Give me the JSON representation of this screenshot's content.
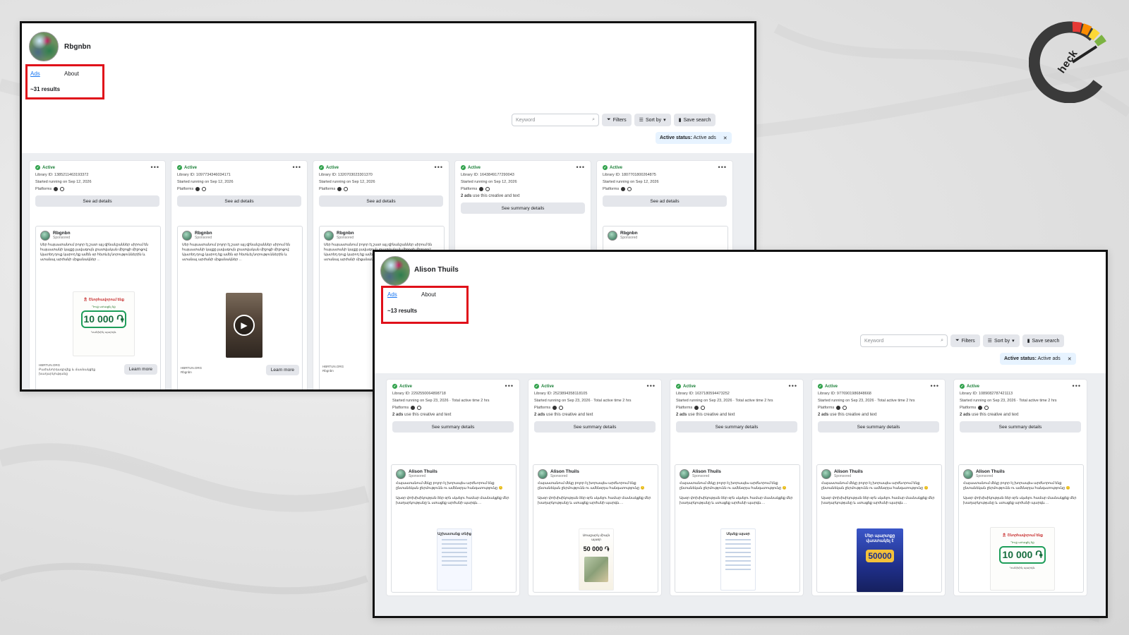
{
  "logo": {
    "text": "heck"
  },
  "common": {
    "tabs": {
      "ads": "Ads",
      "about": "About"
    },
    "keyword_placeholder": "Keyword",
    "filters": "Filters",
    "sort_by": "Sort by",
    "save_search": "Save search",
    "active_status_label": "Active status:",
    "active_status_value": "Active ads",
    "status_active": "Active",
    "platforms": "Platforms",
    "see_ad_details": "See ad details",
    "see_summary_details": "See summary details",
    "sponsored": "Sponsored",
    "learn_more": "Learn more",
    "ads_use_count": "2 ads",
    "ads_use_text": " use this creative and text"
  },
  "window1": {
    "page_name": "Rbgnbn",
    "results": "~31 results",
    "cards": [
      {
        "library_id": "Library ID: 1385211463193372",
        "started": "Started running on Sep 12, 2026",
        "summary": false,
        "creative": "prize",
        "domain": "HBRTUN.ORG",
        "domain_sub": "Բաժանորդագրվեք և մասնակցեք խաղարկությանը",
        "cta": true
      },
      {
        "library_id": "Library ID: 1097734346034171",
        "started": "Started running on Sep 12, 2026",
        "summary": false,
        "creative": "video",
        "domain": "HBRTUN.ORG",
        "domain_sub": "Rbgnbn",
        "cta": true
      },
      {
        "library_id": "Library ID: 1320703023301370",
        "started": "Started running on Sep 12, 2026",
        "summary": false,
        "creative": "none",
        "domain": "HBRTUN.ORG",
        "domain_sub": "Rbgnbn",
        "cta": false
      },
      {
        "library_id": "Library ID: 1643849177290043",
        "started": "Started running on Sep 12, 2026",
        "summary": true
      },
      {
        "library_id": "Library ID: 1807701800264875",
        "started": "Started running on Sep 12, 2026",
        "summary": false
      }
    ],
    "ad_text": "Սեր հայաստանում բոլոր էլ շատ այլ զինանշաններ սիրում են հայաստանի կայքը լավագույն լրատվական միջոցի միջոցով: Այստեղ դուք կարող եք ամեն օր հետևել նորություններին և ստանալ արժանի մրցանակներ ..."
  },
  "window2": {
    "page_name": "Alison Thuils",
    "results": "~13 results",
    "cards": [
      {
        "library_id": "Library ID: 2292550064898718",
        "creative": "doc",
        "creative_title": "Աշխատանք տնից"
      },
      {
        "library_id": "Library ID: 2523894358118105",
        "creative": "money",
        "creative_title": "Առաջարկ միայն այսօր",
        "creative_amount": "50 000 ֏"
      },
      {
        "library_id": "Library ID: 1637180594473252",
        "creative": "doc",
        "creative_title": "Սկսեք այսօր"
      },
      {
        "library_id": "Library ID: 9776901986848668",
        "creative": "blue",
        "creative_title": "Մեր պարտքը վաստակել է",
        "creative_amount": "50000"
      },
      {
        "library_id": "Library ID: 1089082787421113",
        "creative": "prize",
        "creative_title": ""
      }
    ],
    "started": "Started running on Sep 23, 2026 · Total active time 2 hrs",
    "ad_text": "Հայաստանում մեկը բոլոր էլ խորապես արժևորում ենք ընտանեկան ջերմությունն ու ամենօրյա հանգստությունը 🙂\n\nԱյսօր փոխիսիկության ձեր օրն սկսելու համար մասնակցեք մեր խաղարկությանը և ստացեք արժանի պարգև ..."
  },
  "prize_creative": {
    "header": "🎗 Շնորհավորում ենք",
    "sub": "Դուք ստացել եք",
    "amount": "10 000 ֏",
    "footer": "Կանխիկ պարգև"
  }
}
